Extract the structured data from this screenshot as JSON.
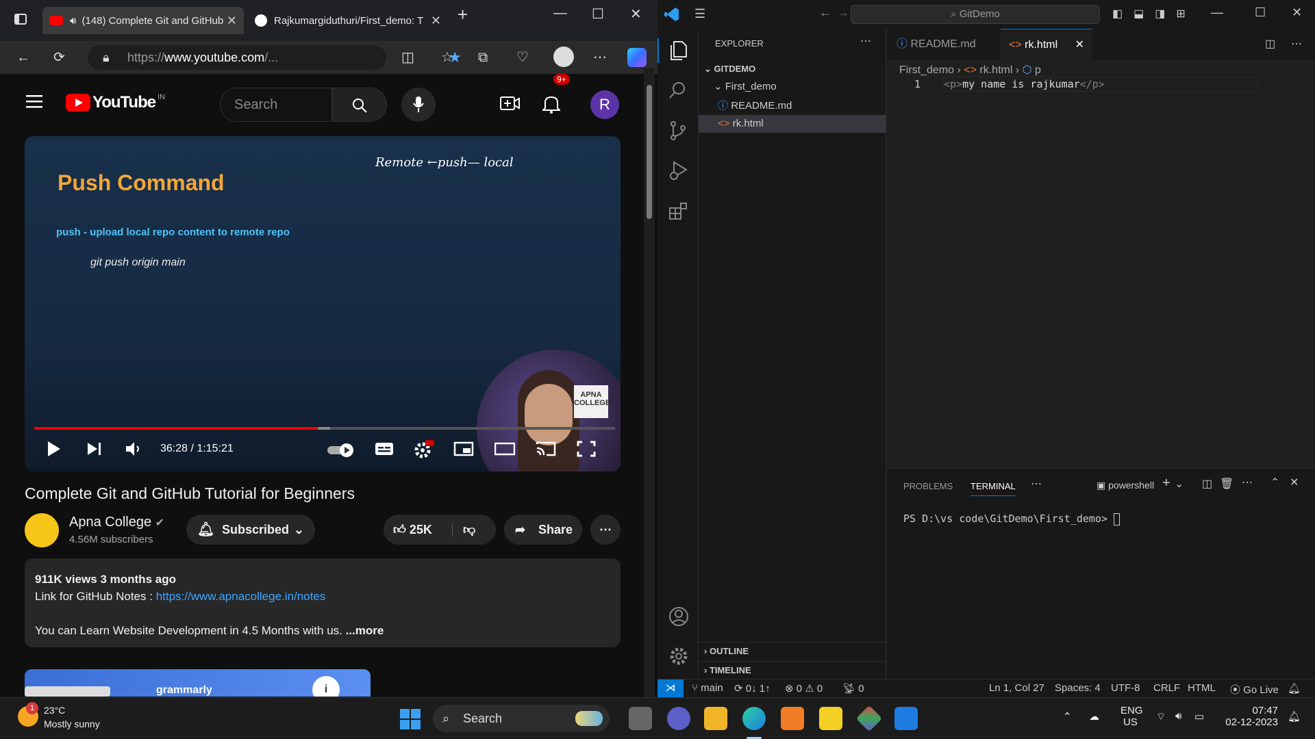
{
  "browser": {
    "tab1_title": "(148) Complete Git and GitHub",
    "tab2_title": "Rajkumargiduthuri/First_demo: T",
    "url_prefix": "https://",
    "url_domain": "www.youtube.com",
    "url_rest": "/..."
  },
  "youtube": {
    "logo_text": "YouTube",
    "region": "IN",
    "search_placeholder": "Search",
    "notif_count": "9+",
    "avatar_letter": "R",
    "video": {
      "slide_title": "Push Command",
      "slide_subtitle": "push - upload local repo content to remote repo",
      "slide_command": "git push origin main",
      "handwriting": "Remote ←push— local",
      "time": "36:28 / 1:15:21",
      "progress": 0.488,
      "buffered": 0.51,
      "watermark": "APNA COLLEGE"
    },
    "video_title": "Complete Git and GitHub Tutorial for Beginners",
    "channel_name": "Apna College",
    "channel_subs": "4.56M subscribers",
    "subscribed_label": "Subscribed",
    "likes": "25K",
    "share_label": "Share",
    "desc": {
      "stats": "911K views  3 months ago",
      "line1_prefix": "Link for GitHub Notes : ",
      "line1_link": "https://www.apnacollege.in/notes",
      "line2": "You can Learn Website Development in 4.5 Months with us.",
      "more": "...more"
    },
    "ad_text": "grammarly"
  },
  "vscode": {
    "command_center": "GitDemo",
    "explorer_title": "EXPLORER",
    "root": "GITDEMO",
    "folder": "First_demo",
    "files": [
      "README.md",
      "rk.html"
    ],
    "tabs": [
      "README.md",
      "rk.html"
    ],
    "breadcrumb": [
      "First_demo",
      "rk.html",
      "p"
    ],
    "line_no": "1",
    "code_open": "<p>",
    "code_text": "my name is rajkumar",
    "code_close": "</p>",
    "panel_tabs": [
      "PROBLEMS",
      "TERMINAL"
    ],
    "shell": "powershell",
    "terminal_prompt": "PS D:\\vs code\\GitDemo\\First_demo>",
    "outline": "OUTLINE",
    "timeline": "TIMELINE",
    "status": {
      "branch": "main",
      "sync": "0↓ 1↑",
      "errors": "0",
      "warnings": "0",
      "ports": "0",
      "position": "Ln 1, Col 27",
      "spaces": "Spaces: 4",
      "encoding": "UTF-8",
      "eol": "CRLF",
      "language": "HTML",
      "golive": "Go Live"
    }
  },
  "taskbar": {
    "weather_temp": "23°C",
    "weather_desc": "Mostly sunny",
    "weather_badge": "1",
    "search": "Search",
    "lang1": "ENG",
    "lang2": "US",
    "time": "07:47",
    "date": "02-12-2023"
  },
  "colors": {
    "yt_red": "#ff0000",
    "vs_blue": "#0078d4",
    "slide_orange": "#f2a63a",
    "link_blue": "#3ea6ff"
  }
}
